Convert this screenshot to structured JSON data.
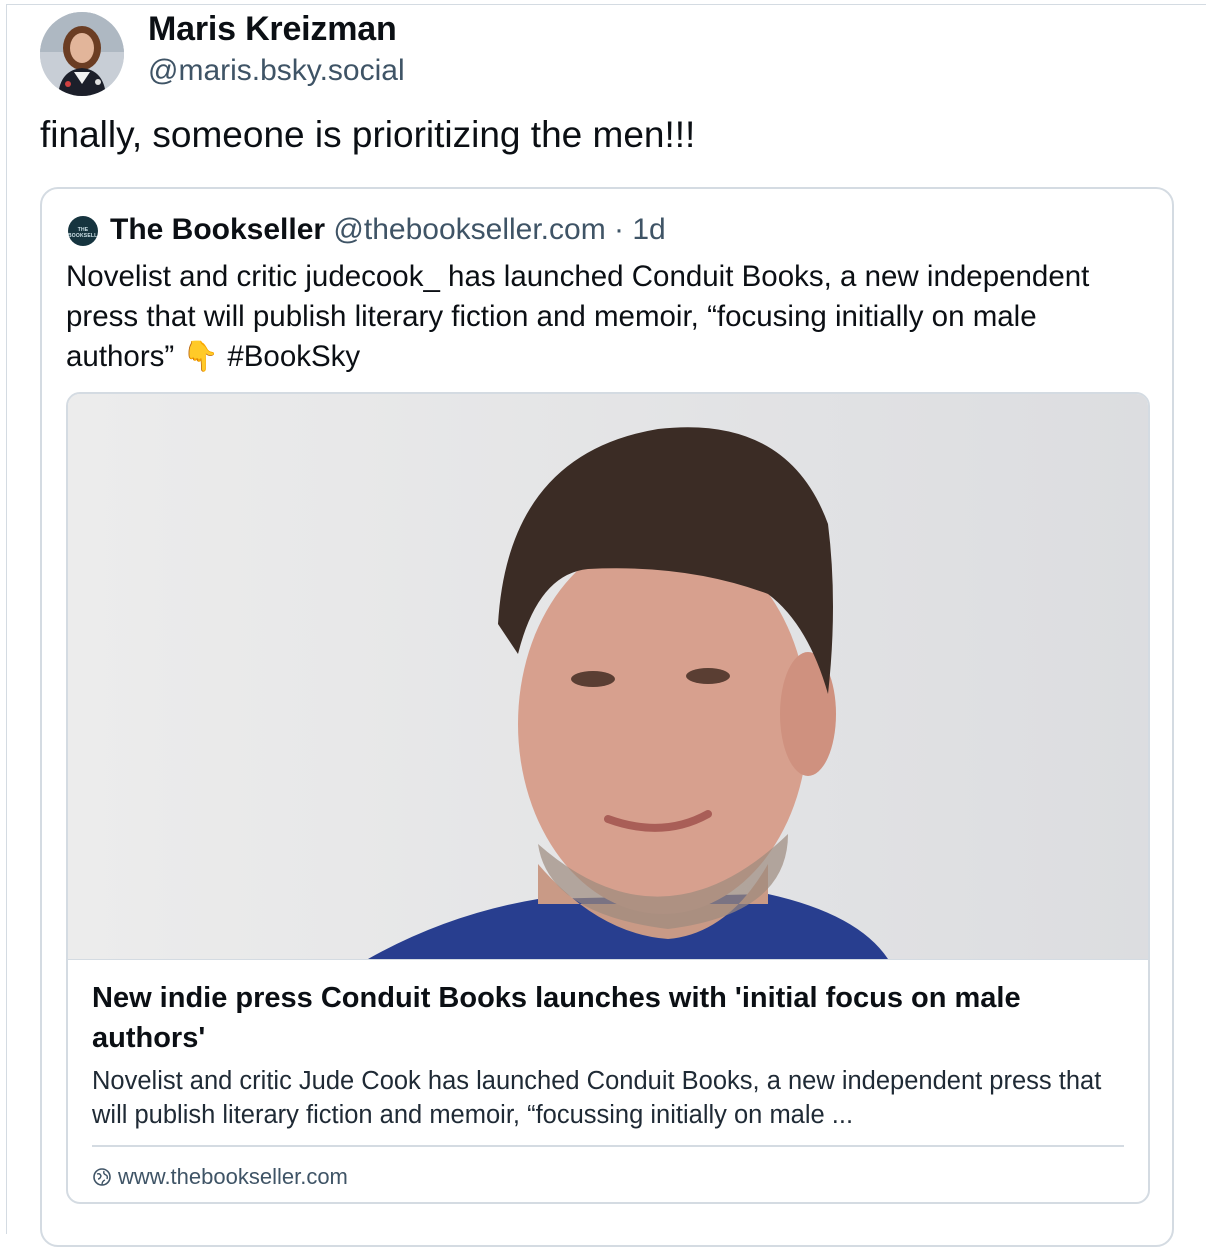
{
  "post": {
    "author": {
      "display_name": "Maris Kreizman",
      "handle": "@maris.bsky.social"
    },
    "text": "finally, someone is prioritizing the men!!!"
  },
  "quoted_post": {
    "author": {
      "avatar_text": "THE BOOKSELLER",
      "display_name": "The Bookseller",
      "handle": "@thebookseller.com",
      "separator": "·",
      "time": "1d"
    },
    "text": "Novelist and critic judecook_ has launched Conduit Books, a new independent press that will publish literary fiction and memoir, “focusing initially on male authors” 👇 #BookSky",
    "link_card": {
      "image_description_icon": "photo-of-man",
      "title": "New indie press Conduit Books launches with 'initial focus on male authors'",
      "description": "Novelist and critic Jude Cook has launched Conduit Books, a new independent press that will publish literary fiction and memoir, “focussing initially on male ...",
      "domain": "www.thebookseller.com"
    }
  },
  "colors": {
    "secondary_text": "#3f5466",
    "border": "#d4dbe2"
  }
}
